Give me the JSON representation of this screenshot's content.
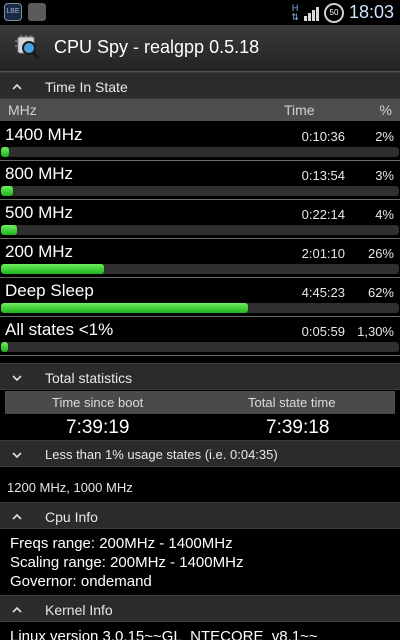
{
  "status_bar": {
    "left_icon_a": "LBE",
    "network_label": "H",
    "network_arrows": "⇅",
    "battery_level": "50",
    "clock": "18:03"
  },
  "app": {
    "title": "CPU Spy - realgpp 0.5.18"
  },
  "time_in_state": {
    "header": "Time In State",
    "columns": {
      "name": "MHz",
      "time": "Time",
      "pct": "%"
    },
    "rows": [
      {
        "name": "1400 MHz",
        "time": "0:10:36",
        "pct": "2%",
        "fill_fraction": 0.02
      },
      {
        "name": "800 MHz",
        "time": "0:13:54",
        "pct": "3%",
        "fill_fraction": 0.03
      },
      {
        "name": "500 MHz",
        "time": "0:22:14",
        "pct": "4%",
        "fill_fraction": 0.04
      },
      {
        "name": "200 MHz",
        "time": "2:01:10",
        "pct": "26%",
        "fill_fraction": 0.26
      },
      {
        "name": "Deep Sleep",
        "time": "4:45:23",
        "pct": "62%",
        "fill_fraction": 0.62
      },
      {
        "name": "All states <1%",
        "time": "0:05:59",
        "pct": "1,30%",
        "fill_fraction": 0.013
      }
    ]
  },
  "total_statistics": {
    "header": "Total statistics",
    "time_since_boot_label": "Time since boot",
    "total_state_time_label": "Total state time",
    "time_since_boot": "7:39:19",
    "total_state_time": "7:39:18"
  },
  "less_than_1pct": {
    "header": "Less than 1% usage states (i.e. 0:04:35)",
    "states": "1200 MHz, 1000 MHz"
  },
  "cpu_info": {
    "header": "Cpu Info",
    "freqs_range": "Freqs range: 200MHz - 1400MHz",
    "scaling_range": "Scaling range: 200MHz - 1400MHz",
    "governor": "Governor: ondemand"
  },
  "kernel_info": {
    "header": "Kernel Info",
    "version_partial": "Linux version 3.0.15~~GL_NTECORE_v8.1~~"
  },
  "colors": {
    "bar_fill": "#2ecc2e",
    "header_bg": "#2b2b2b",
    "column_header_bg": "#4e4e4e"
  }
}
